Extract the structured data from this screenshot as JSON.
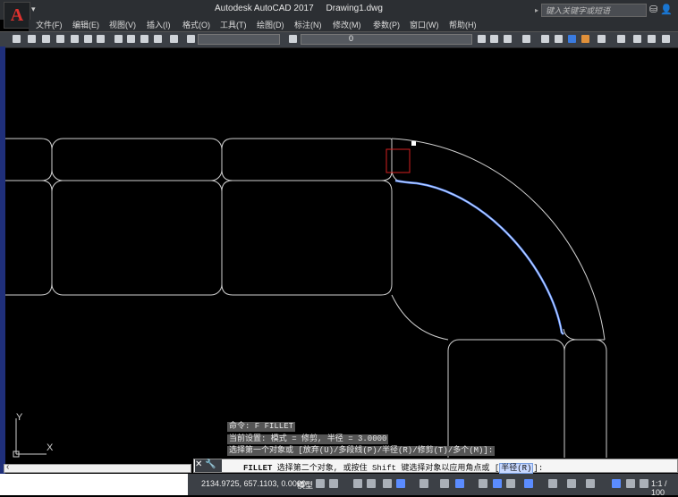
{
  "title": {
    "app": "Autodesk AutoCAD 2017",
    "document": "Drawing1.dwg",
    "logo": "A"
  },
  "search": {
    "placeholder": "键入关键字或短语"
  },
  "menu": [
    {
      "label": "文件(F)"
    },
    {
      "label": "编辑(E)"
    },
    {
      "label": "视图(V)"
    },
    {
      "label": "插入(I)"
    },
    {
      "label": "格式(O)"
    },
    {
      "label": "工具(T)"
    },
    {
      "label": "绘图(D)"
    },
    {
      "label": "标注(N)"
    },
    {
      "label": "修改(M)"
    },
    {
      "label": "参数(P)"
    },
    {
      "label": "窗口(W)"
    },
    {
      "label": "帮助(H)"
    }
  ],
  "layer": {
    "current": "0"
  },
  "command_history": [
    "命令: F FILLET",
    "当前设置: 模式 = 修剪, 半径 = 3.0000",
    "选择第一个对象或 [放弃(U)/多段线(P)/半径(R)/修剪(T)/多个(M)]:"
  ],
  "command_line": {
    "keyword": "FILLET",
    "prompt": " 选择第二个对象, 或按住 Shift 键选择对象以应用角点或 [",
    "option": "半径(R)",
    "end": "]:"
  },
  "status": {
    "coordinates": "2134.9725, 657.1103, 0.0000",
    "model": "模型",
    "scale": "1:1 / 100"
  },
  "ucs": {
    "x": "X",
    "y": "Y"
  },
  "colors": {
    "highlight": "#5b8cff",
    "selection_box": "#d42020",
    "geometry": "#d0d0d0"
  }
}
